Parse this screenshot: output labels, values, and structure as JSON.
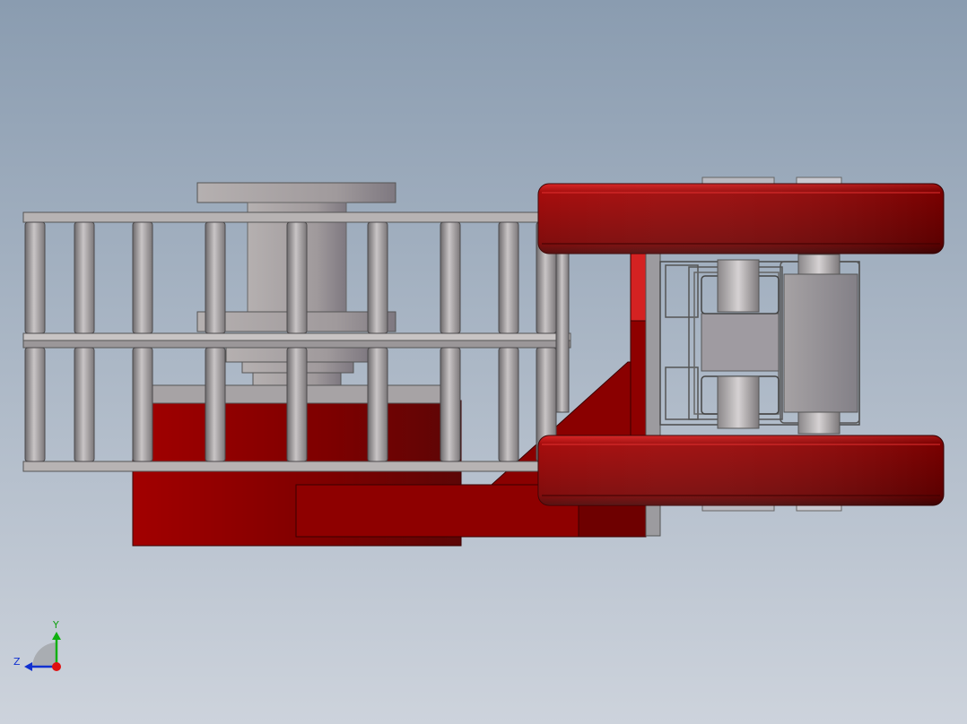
{
  "viewport": {
    "background_top": "#8a9cb0",
    "background_bottom": "#cdd3dc"
  },
  "model": {
    "body_red": "#8b0000",
    "body_red_light": "#c41414",
    "body_red_dark": "#5a0505",
    "steel_gray": "#a8a3a6",
    "steel_dark": "#6c6a6e"
  },
  "triad": {
    "y_label": "Y",
    "z_label": "Z",
    "x_color": "#e01010",
    "y_color": "#10b010",
    "z_color": "#1030d0"
  }
}
